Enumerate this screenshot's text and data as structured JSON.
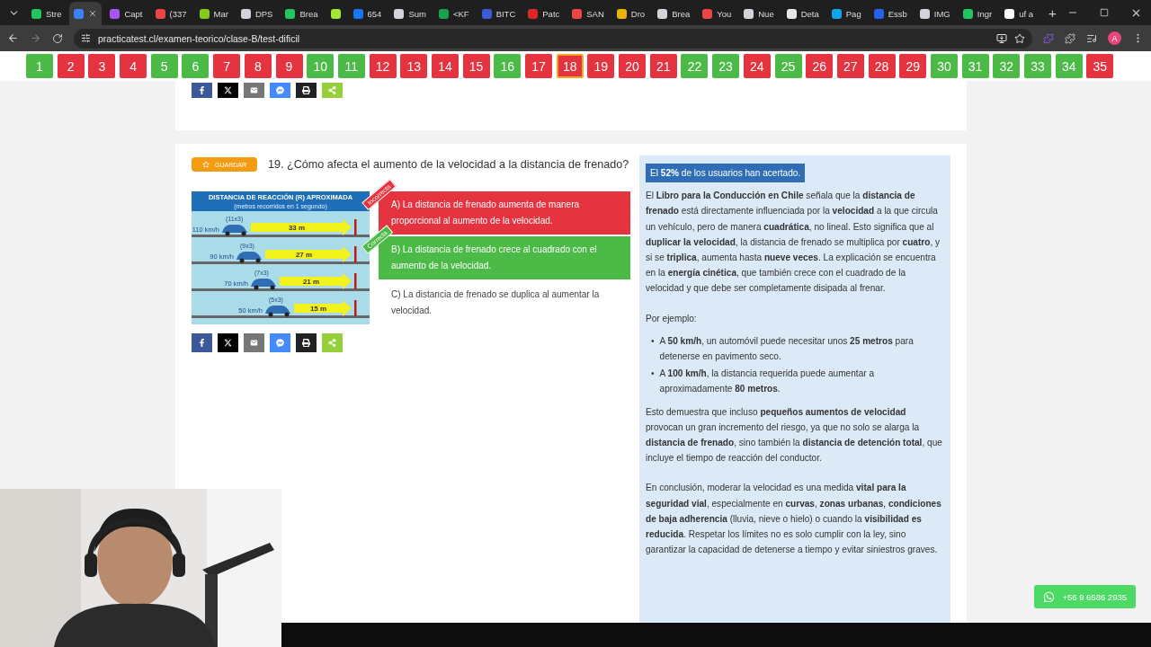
{
  "browser": {
    "tabs": [
      {
        "title": "Stre",
        "color": "#22c55e",
        "selected": false
      },
      {
        "color": "#3b82f6",
        "selected": true
      },
      {
        "title": "Capt",
        "color": "#a855f7",
        "selected": false
      },
      {
        "title": "(337",
        "color": "#ef4444",
        "selected": false
      },
      {
        "title": "Mar",
        "color": "#84cc16",
        "selected": false
      },
      {
        "title": "DPS",
        "color": "#d1d5db",
        "selected": false
      },
      {
        "title": "Brea",
        "color": "#22c55e",
        "selected": false
      },
      {
        "color": "#a3e635",
        "selected": false
      },
      {
        "title": "654",
        "color": "#1877f2",
        "selected": false
      },
      {
        "title": "Sum",
        "color": "#d1d5db",
        "selected": false
      },
      {
        "title": "<KF",
        "color": "#16a34a",
        "selected": false
      },
      {
        "title": "BITC",
        "color": "#3b5bdb",
        "selected": false
      },
      {
        "title": "Patc",
        "color": "#dc2626",
        "selected": false
      },
      {
        "title": "SAN",
        "color": "#ef4444",
        "selected": false
      },
      {
        "title": "Dro",
        "color": "#eab308",
        "selected": false
      },
      {
        "title": "Brea",
        "color": "#d1d5db",
        "selected": false
      },
      {
        "title": "You",
        "color": "#ef4444",
        "selected": false
      },
      {
        "title": "Nue",
        "color": "#d1d5db",
        "selected": false
      },
      {
        "title": "Deta",
        "color": "#e5e7eb",
        "selected": false
      },
      {
        "title": "Pag",
        "color": "#0ea5e9",
        "selected": false
      },
      {
        "title": "Essb",
        "color": "#2563eb",
        "selected": false
      },
      {
        "title": "IMG",
        "color": "#d1d5db",
        "selected": false
      },
      {
        "title": "Ingr",
        "color": "#22c55e",
        "selected": false
      },
      {
        "title": "uf a",
        "color": "#ffffff",
        "selected": false
      }
    ],
    "new_tab": "+",
    "url": "practicatest.cl/examen-teorico/clase-B/test-dificil",
    "profile": "A"
  },
  "question_numbers": [
    {
      "label": "1",
      "correct": true,
      "selected": false
    },
    {
      "label": "2",
      "correct": false,
      "selected": false
    },
    {
      "label": "3",
      "correct": false,
      "selected": false
    },
    {
      "label": "4",
      "correct": false,
      "selected": false
    },
    {
      "label": "5",
      "correct": true,
      "selected": false
    },
    {
      "label": "6",
      "correct": true,
      "selected": false
    },
    {
      "label": "7",
      "correct": false,
      "selected": false
    },
    {
      "label": "8",
      "correct": false,
      "selected": false
    },
    {
      "label": "9",
      "correct": false,
      "selected": false
    },
    {
      "label": "10",
      "correct": true,
      "selected": false
    },
    {
      "label": "11",
      "correct": true,
      "selected": false
    },
    {
      "label": "12",
      "correct": false,
      "selected": false
    },
    {
      "label": "13",
      "correct": false,
      "selected": false
    },
    {
      "label": "14",
      "correct": false,
      "selected": false
    },
    {
      "label": "15",
      "correct": false,
      "selected": false
    },
    {
      "label": "16",
      "correct": true,
      "selected": false
    },
    {
      "label": "17",
      "correct": false,
      "selected": false
    },
    {
      "label": "18",
      "correct": false,
      "selected": true
    },
    {
      "label": "19",
      "correct": false,
      "selected": false
    },
    {
      "label": "20",
      "correct": false,
      "selected": false
    },
    {
      "label": "21",
      "correct": false,
      "selected": false
    },
    {
      "label": "22",
      "correct": true,
      "selected": false
    },
    {
      "label": "23",
      "correct": true,
      "selected": false
    },
    {
      "label": "24",
      "correct": false,
      "selected": false
    },
    {
      "label": "25",
      "correct": true,
      "selected": false
    },
    {
      "label": "26",
      "correct": false,
      "selected": false
    },
    {
      "label": "27",
      "correct": false,
      "selected": false
    },
    {
      "label": "28",
      "correct": false,
      "selected": false
    },
    {
      "label": "29",
      "correct": false,
      "selected": false
    },
    {
      "label": "30",
      "correct": true,
      "selected": false
    },
    {
      "label": "31",
      "correct": true,
      "selected": false
    },
    {
      "label": "32",
      "correct": true,
      "selected": false
    },
    {
      "label": "33",
      "correct": true,
      "selected": false
    },
    {
      "label": "34",
      "correct": true,
      "selected": false
    },
    {
      "label": "35",
      "correct": false,
      "selected": false
    }
  ],
  "previous_share": [
    {
      "kind": "facebook"
    },
    {
      "kind": "x"
    },
    {
      "kind": "email"
    },
    {
      "kind": "messenger"
    },
    {
      "kind": "print"
    },
    {
      "kind": "share"
    }
  ],
  "question": {
    "save_label": "GUARDAR",
    "title": "19. ¿Cómo afecta el aumento de la velocidad a la distancia de frenado?",
    "infographic": {
      "title": "DISTANCIA DE REACCIÓN (R) APROXIMADA",
      "subtitle": "(metros recorridos en 1 segundo)",
      "rows": [
        {
          "speed": "110 km/h",
          "factor": "(11x3)",
          "distance": "33 m"
        },
        {
          "speed": "90 km/h",
          "factor": "(9x3)",
          "distance": "27 m"
        },
        {
          "speed": "70 km/h",
          "factor": "(7x3)",
          "distance": "21 m"
        },
        {
          "speed": "50 km/h",
          "factor": "(5x3)",
          "distance": "15 m"
        }
      ]
    },
    "answers": [
      {
        "text": "A) La distancia de frenado aumenta de manera proporcional al aumento de la velocidad.",
        "kind": "incorrect",
        "ribbon": "Incorrecta"
      },
      {
        "text": "B) La distancia de frenado crece al cuadrado con el aumento de la velocidad.",
        "kind": "correct",
        "ribbon": "Correcta"
      },
      {
        "text": "C) La distancia de frenado se duplica al aumentar la velocidad.",
        "kind": "plain"
      }
    ],
    "share": [
      {
        "kind": "facebook"
      },
      {
        "kind": "x"
      },
      {
        "kind": "email"
      },
      {
        "kind": "messenger"
      },
      {
        "kind": "print"
      },
      {
        "kind": "share"
      }
    ]
  },
  "explanation": {
    "stat": "El **52%** de los usuarios han acertado.",
    "blocks": [
      {
        "kind": "paragraph",
        "text": "El **Libro para la Conducción en Chile** señala que la **distancia de frenado** está directamente influenciada por la **velocidad** a la que circula un vehículo, pero de manera **cuadrática**, no lineal. Esto significa que al **duplicar la velocidad**, la distancia de frenado se multiplica por **cuatro**, y si se **triplica**, aumenta hasta **nueve veces**. La explicación se encuentra en la **energía cinética**, que también crece con el cuadrado de la velocidad y que debe ser completamente disipada al frenar."
      },
      {
        "kind": "paragraph",
        "text": "Por ejemplo:"
      },
      {
        "kind": "list",
        "items": [
          {
            "marker": "•",
            "text": "A **50 km/h**, un automóvil puede necesitar unos **25 metros** para detenerse en pavimento seco."
          },
          {
            "marker": "•",
            "text": "A **100 km/h**, la distancia requerida puede aumentar a aproximadamente **80 metros**."
          }
        ]
      },
      {
        "kind": "paragraph",
        "text": "Esto demuestra que incluso **pequeños aumentos de velocidad** provocan un gran incremento del riesgo, ya que no solo se alarga la **distancia de frenado**, sino también la **distancia de detención total**, que incluye el tiempo de reacción del conductor."
      },
      {
        "kind": "paragraph",
        "text": "En conclusión, moderar la velocidad es una medida **vital para la seguridad vial**, especialmente en **curvas**, **zonas urbanas**, **condiciones de baja adherencia** (lluvia, nieve o hielo) o cuando la **visibilidad es reducida**. Respetar los límites no es solo cumplir con la ley, sino garantizar la capacidad de detenerse a tiempo y evitar siniestros graves."
      }
    ]
  },
  "whatsapp": "+56 9 6586 2935"
}
